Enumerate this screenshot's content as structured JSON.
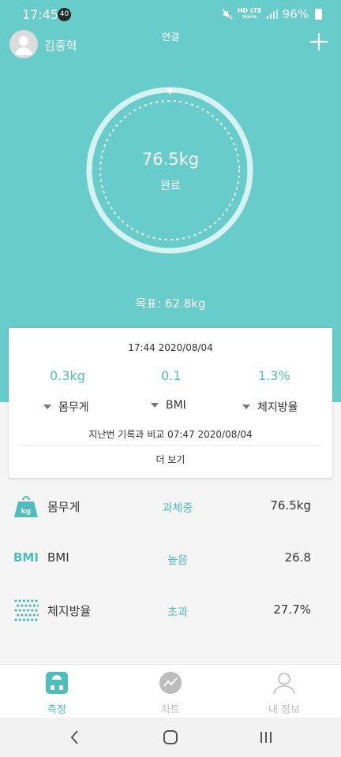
{
  "status_bar": {
    "time": "17:45",
    "notif_badge": "40",
    "net_top": "HD LTE",
    "net_bottom": "Voice",
    "battery": "96%"
  },
  "header": {
    "username": "김종혁",
    "connection": "연결"
  },
  "measurement": {
    "weight": "76.5kg",
    "status": "완료",
    "goal": "목표: 62.8kg"
  },
  "card": {
    "timestamp": "17:44 2020/08/04",
    "deltas": [
      "0.3kg",
      "0.1",
      "1.3%"
    ],
    "metrics": [
      "몸무게",
      "BMI",
      "체지방율"
    ],
    "compare": "지난번 기록과 비교 07:47 2020/08/04",
    "more": "더 보기"
  },
  "rows": [
    {
      "icon": "kg-weight-icon",
      "icon_text": "kg",
      "label": "몸무게",
      "status": "과체중",
      "value": "76.5kg"
    },
    {
      "icon": "bmi-icon",
      "icon_text": "BMI",
      "label": "BMI",
      "status": "높음",
      "value": "26.8"
    },
    {
      "icon": "body-fat-dots-icon",
      "label": "체지방율",
      "status": "초과",
      "value": "27.7%"
    }
  ],
  "bottom_nav": [
    {
      "icon": "scale-icon",
      "label": "측정",
      "active": true
    },
    {
      "icon": "chart-icon",
      "label": "차트",
      "active": false
    },
    {
      "icon": "person-icon",
      "label": "내 정보",
      "active": false
    }
  ],
  "colors": {
    "teal": "#68ccca",
    "accent": "#4fbdbb"
  }
}
